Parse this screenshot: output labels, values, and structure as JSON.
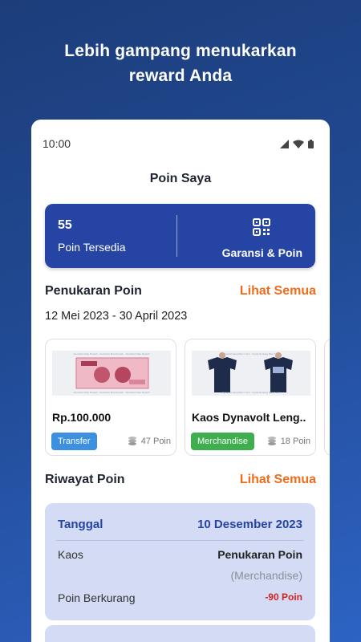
{
  "promo": {
    "line1": "Lebih gampang menukarkan",
    "line2": "reward Anda"
  },
  "statusbar": {
    "time": "10:00",
    "icons": [
      "signal-icon",
      "wifi-icon",
      "battery-icon"
    ]
  },
  "page_title": "Poin Saya",
  "points_card": {
    "value": "55",
    "label": "Poin Tersedia",
    "right_label": "Garansi & Poin",
    "right_icon": "qr-scan-icon"
  },
  "redeem_section": {
    "title": "Penukaran Poin",
    "see_all": "Lihat Semua",
    "date_range": "12 Mei 2023 - 30 April 2023",
    "items": [
      {
        "name": "Rp.100.000",
        "badge": "Transfer",
        "points": "47 Poin",
        "image": "money-banknote-image"
      },
      {
        "name": "Kaos Dynavolt Leng..",
        "badge": "Merchandise",
        "points": "18 Poin",
        "image": "tshirt-image"
      }
    ]
  },
  "history_section": {
    "title": "Riwayat Poin",
    "see_all": "Lihat Semua",
    "entry": {
      "date_label": "Tanggal",
      "date_value": "10 Desember 2023",
      "item": "Kaos",
      "type": "Penukaran Poin",
      "category": "(Merchandise)",
      "points_label": "Poin Berkurang",
      "points_value": "-90 Poin"
    }
  },
  "colors": {
    "primary": "#2544a3",
    "accent": "#ef6c1a",
    "negative": "#d3231f",
    "history_bg": "#d3dcf4"
  }
}
